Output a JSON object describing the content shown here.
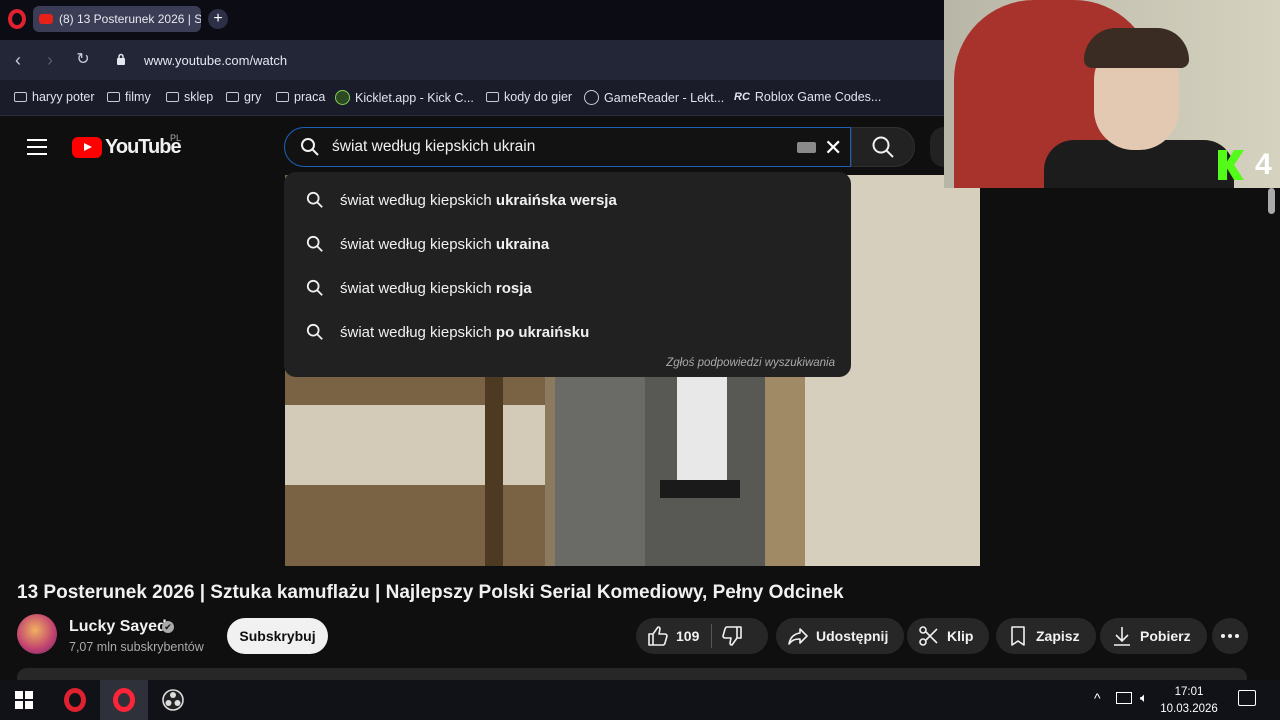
{
  "browser": {
    "tab_title": "(8) 13 Posterunek 2026 | S",
    "new_tab": "+",
    "url": "www.youtube.com/watch",
    "bookmarks": [
      {
        "label": "haryy poter",
        "icon": "folder-icon"
      },
      {
        "label": "filmy",
        "icon": "folder-icon"
      },
      {
        "label": "sklep",
        "icon": "folder-icon"
      },
      {
        "label": "gry",
        "icon": "folder-icon"
      },
      {
        "label": "praca",
        "icon": "folder-icon"
      },
      {
        "label": "Kicklet.app - Kick C...",
        "icon": "kicklet-icon"
      },
      {
        "label": "kody do gier",
        "icon": "folder-icon"
      },
      {
        "label": "GameReader - Lekt...",
        "icon": "gamereader-icon"
      },
      {
        "label": "Roblox Game Codes...",
        "icon": "rc-icon"
      }
    ],
    "rc_badge": "RC"
  },
  "youtube": {
    "logo_text": "YouTube",
    "country": "PL",
    "search_query": "świat według kiepskich ukrain",
    "suggestions": [
      {
        "prefix": "świat według kiepskich ",
        "bold": "ukraińska wersja"
      },
      {
        "prefix": "świat według kiepskich ",
        "bold": "ukraina"
      },
      {
        "prefix": "świat według kiepskich ",
        "bold": "rosja"
      },
      {
        "prefix": "świat według kiepskich ",
        "bold": "po ukraińsku"
      }
    ],
    "report_suggestions": "Zgłoś podpowiedzi wyszukiwania"
  },
  "overlay": {
    "kick_count": "4"
  },
  "video": {
    "title": "13 Posterunek 2026 | Sztuka kamuflażu | Najlepszy Polski Serial Komediowy, Pełny Odcinek",
    "channel": "Lucky Sayed",
    "verified_mark": "✔",
    "subscribers": "7,07 mln subskrybentów",
    "subscribe_label": "Subskrybuj",
    "likes": "109",
    "share_label": "Udostępnij",
    "clip_label": "Klip",
    "save_label": "Zapisz",
    "download_label": "Pobierz"
  },
  "taskbar": {
    "time": "17:01",
    "date": "10.03.2026"
  }
}
